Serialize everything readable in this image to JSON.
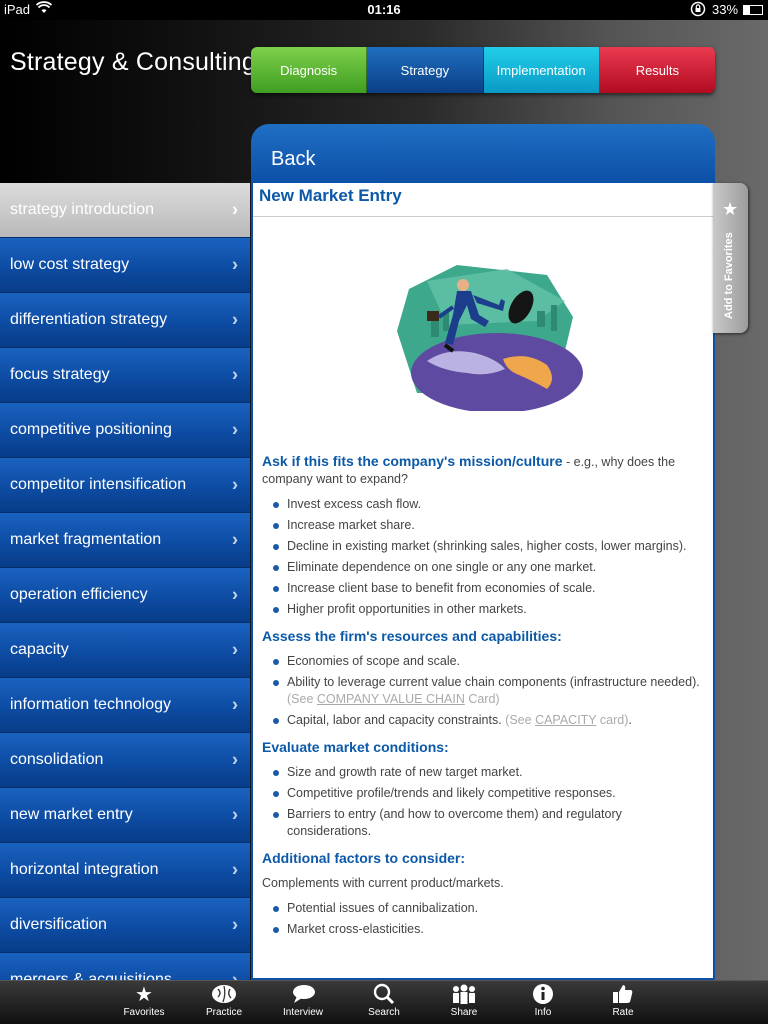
{
  "status": {
    "carrier": "iPad",
    "time": "01:16",
    "battery": "33%"
  },
  "app_title": "Strategy & Consulting",
  "tabs": [
    {
      "label": "Diagnosis",
      "color": "#4fb22c"
    },
    {
      "label": "Strategy",
      "color": "#0b4f9c"
    },
    {
      "label": "Implementation",
      "color": "#13b6dc"
    },
    {
      "label": "Results",
      "color": "#d01c34"
    }
  ],
  "back_label": "Back",
  "add_to_favorites": "Add to Favorites",
  "sidebar": {
    "items": [
      {
        "label": "strategy introduction"
      },
      {
        "label": "low cost strategy"
      },
      {
        "label": "differentiation strategy"
      },
      {
        "label": "focus strategy"
      },
      {
        "label": "competitive positioning"
      },
      {
        "label": "competitor intensification"
      },
      {
        "label": "market fragmentation"
      },
      {
        "label": "operation efficiency"
      },
      {
        "label": "capacity"
      },
      {
        "label": "information technology"
      },
      {
        "label": "consolidation"
      },
      {
        "label": "new market entry"
      },
      {
        "label": "horizontal integration"
      },
      {
        "label": "diversification"
      },
      {
        "label": "mergers & acquisitions"
      }
    ]
  },
  "article": {
    "title": "New Market Entry",
    "s1_heading": "Ask if this fits the company's mission/culture",
    "s1_note": " - e.g., why does the company want to expand?",
    "s1_items": [
      "Invest excess cash flow.",
      "Increase market share.",
      "Decline in existing market (shrinking sales, higher costs, lower margins).",
      "Eliminate dependence on one single or any one market.",
      "Increase client base to benefit from economies of scale.",
      "Higher profit opportunities in other markets."
    ],
    "s2_heading": "Assess the firm's resources and capabilities:",
    "s2_item1": "Economies of scope and scale.",
    "s2_item2": "Ability to leverage current value chain components (infrastructure needed).",
    "s2_item2_ref_pre": " (See ",
    "s2_item2_ref_link": "COMPANY VALUE CHAIN",
    "s2_item2_ref_post": " Card)",
    "s2_item3": "Capital, labor and capacity constraints.",
    "s2_item3_ref_pre": " (See ",
    "s2_item3_ref_link": "CAPACITY",
    "s2_item3_ref_post": " card)",
    "s2_item3_end": ".",
    "s3_heading": "Evaluate market conditions:",
    "s3_items": [
      "Size and growth rate of new target market.",
      "Competitive profile/trends and likely competitive responses.",
      "Barriers to entry (and how to overcome them) and regulatory considerations."
    ],
    "s4_heading": "Additional factors to consider:",
    "s4_text": "Complements with current product/markets.",
    "s4_items": [
      "Potential issues of cannibalization.",
      "Market cross-elasticities."
    ]
  },
  "toolbar": [
    {
      "label": "Favorites",
      "icon": "star-icon"
    },
    {
      "label": "Practice",
      "icon": "brain-icon"
    },
    {
      "label": "Interview",
      "icon": "chat-icon"
    },
    {
      "label": "Search",
      "icon": "search-icon"
    },
    {
      "label": "Share",
      "icon": "people-icon"
    },
    {
      "label": "Info",
      "icon": "info-icon"
    },
    {
      "label": "Rate",
      "icon": "thumbs-up-icon"
    }
  ]
}
